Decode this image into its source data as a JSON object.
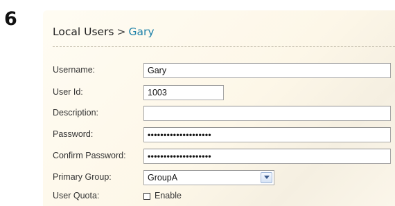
{
  "step_number": "6",
  "breadcrumb": {
    "parent": "Local Users",
    "separator": ">",
    "current": "Gary"
  },
  "form": {
    "username": {
      "label": "Username:",
      "value": "Gary"
    },
    "user_id": {
      "label": "User Id:",
      "value": "1003"
    },
    "description": {
      "label": "Description:",
      "value": ""
    },
    "password": {
      "label": "Password:",
      "value": "••••••••••••••••••••"
    },
    "confirm_password": {
      "label": "Confirm Password:",
      "value": "••••••••••••••••••••"
    },
    "primary_group": {
      "label": "Primary Group:",
      "value": "GroupA"
    },
    "user_quota": {
      "label": "User Quota:",
      "checkbox_label": "Enable",
      "checked": false
    }
  }
}
